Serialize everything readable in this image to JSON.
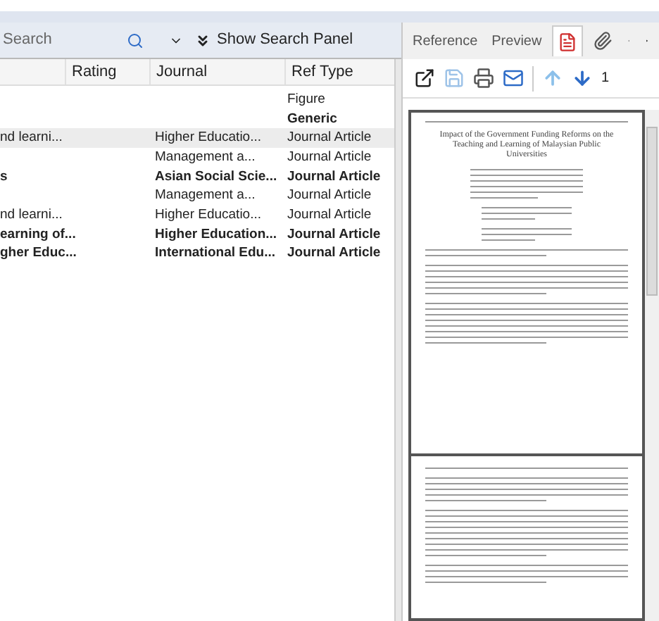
{
  "search": {
    "placeholder": "Search"
  },
  "search_panel_button": "Show Search Panel",
  "table": {
    "columns": [
      {
        "label": "Rating"
      },
      {
        "label": "Journal"
      },
      {
        "label": "Ref Type"
      }
    ],
    "rows": [
      {
        "ref_type": "Figure",
        "bold": false,
        "selected": false
      },
      {
        "ref_type": "Generic",
        "bold": true,
        "selected": false
      },
      {
        "title": "nd learni...",
        "journal": "Higher Educatio...",
        "ref_type": "Journal Article",
        "bold": false,
        "selected": true
      },
      {
        "journal": "Management a...",
        "ref_type": "Journal Article",
        "bold": false,
        "selected": false
      },
      {
        "title": "s",
        "journal": "Asian Social Scie...",
        "ref_type": "Journal Article",
        "bold": true,
        "selected": false
      },
      {
        "journal": "Management a...",
        "ref_type": "Journal Article",
        "bold": false,
        "selected": false
      },
      {
        "title": "nd learni...",
        "journal": "Higher Educatio...",
        "ref_type": "Journal Article",
        "bold": false,
        "selected": false
      },
      {
        "title": "earning of...",
        "journal": "Higher Education...",
        "ref_type": "Journal Article",
        "bold": true,
        "selected": false
      },
      {
        "title": "gher Educ...",
        "journal": "International Edu...",
        "ref_type": "Journal Article",
        "bold": true,
        "selected": false
      }
    ]
  },
  "panel_tabs": [
    {
      "label": "Reference",
      "kind": "text",
      "selected": false
    },
    {
      "label": "Preview",
      "kind": "text",
      "selected": false
    },
    {
      "kind": "pdf",
      "selected": true
    },
    {
      "kind": "attachment",
      "selected": false
    }
  ],
  "page_number": "1",
  "pdf": {
    "title": "Impact of the Government Funding Reforms on the Teaching and Learning of Malaysian Public Universities"
  }
}
